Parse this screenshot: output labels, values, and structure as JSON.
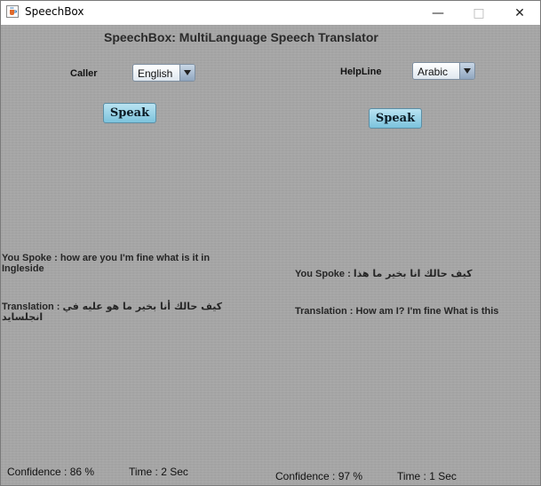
{
  "window": {
    "title": "SpeechBox"
  },
  "heading": "SpeechBox:  MultiLanguage Speech Translator",
  "caller": {
    "label": "Caller",
    "language": "English",
    "speak_label": "Speak",
    "spoke_prefix": "You Spoke : ",
    "spoke_text": "how are you I'm fine what is it in Ingleside",
    "translation_prefix": "Translation : ",
    "translation_text": "كيف حالك أنا بخير ما هو عليه في انجلسايد",
    "confidence": "Confidence : 86 %",
    "time": "Time : 2 Sec"
  },
  "helpline": {
    "label": "HelpLine",
    "language": "Arabic",
    "speak_label": "Speak",
    "spoke_prefix": "You Spoke : ",
    "spoke_text": "كيف حالك انا بخير ما هذا",
    "translation_prefix": "Translation : ",
    "translation_text": "How am I? I'm fine What is this",
    "confidence": "Confidence : 97 %",
    "time": "Time : 1 Sec"
  },
  "icons": {
    "app": "java-coffee-icon",
    "minimize": "minimize-icon",
    "maximize": "maximize-icon",
    "close": "close-icon"
  }
}
